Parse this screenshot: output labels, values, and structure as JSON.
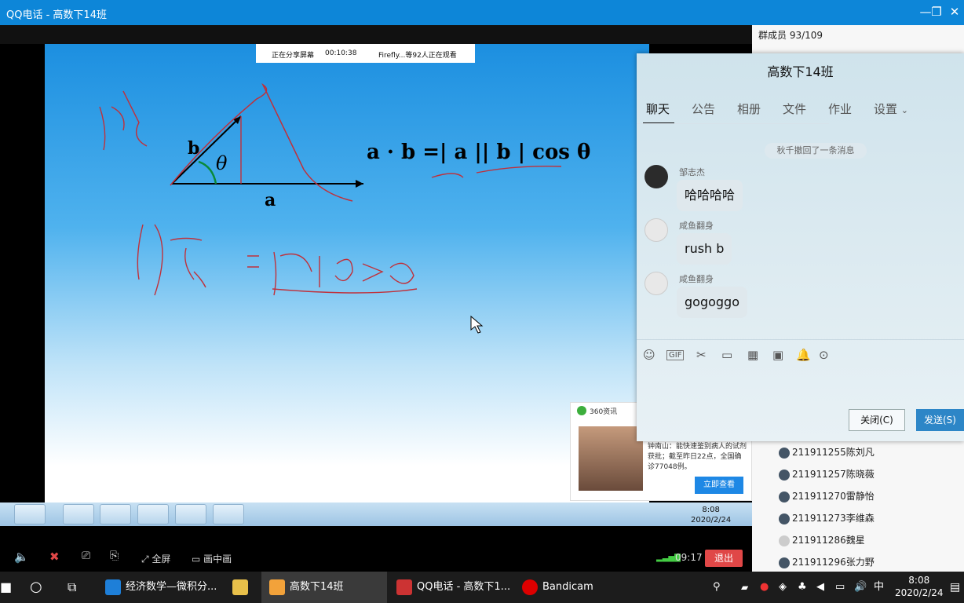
{
  "window": {
    "title": "QQ电话 - 高数下14班"
  },
  "share_banner": {
    "status": "正在分享屏幕",
    "time": "00:10:38",
    "viewers": "Firefly...等92人正在观看"
  },
  "formula": {
    "text": "a · b =| a || b | cos θ"
  },
  "remote_taskbar": {
    "clock_time": "8:08",
    "clock_date": "2020/2/24"
  },
  "news_popup": {
    "source": "360资讯",
    "text": "钟南山：能快速鉴别病人的试剂获批；截至昨日22点，全国确诊77048例。",
    "button": "立即查看"
  },
  "controls": {
    "fullscreen": "全屏",
    "pip": "画中画",
    "duration": "09:17",
    "quit": "退出"
  },
  "members": {
    "header": "群成员 93/109",
    "list": [
      "211911255陈刘凡",
      "211911257陈晓薇",
      "211911270雷静怡",
      "211911273李维森",
      "211911286魏星",
      "211911296张力野"
    ]
  },
  "chat": {
    "title": "高数下14班",
    "tabs": [
      "聊天",
      "公告",
      "相册",
      "文件",
      "作业",
      "设置"
    ],
    "system_message": "秋千撤回了一条消息",
    "messages": [
      {
        "sender": "邹志杰",
        "text": "哈哈哈哈"
      },
      {
        "sender": "咸鱼翻身",
        "text": "rush b"
      },
      {
        "sender": "咸鱼翻身",
        "text": "gogoggo"
      }
    ],
    "close_button": "关闭(C)",
    "send_button": "发送(S)"
  },
  "taskbar": {
    "items": [
      "经济数学—微积分...",
      "高数下14班",
      "QQ电话 - 高数下1...",
      "Bandicam"
    ],
    "ime": "中",
    "clock_time": "8:08",
    "clock_date": "2020/2/24"
  },
  "colors": {
    "accent": "#0d86d8",
    "quit": "#e04747",
    "send": "#2d86c7"
  }
}
